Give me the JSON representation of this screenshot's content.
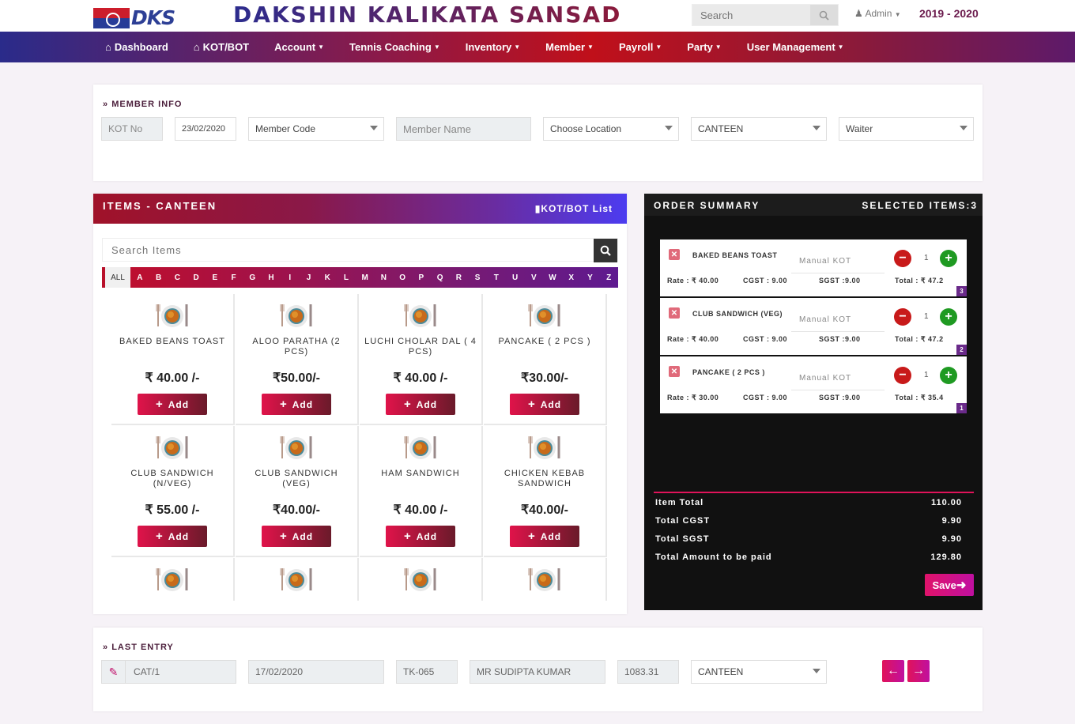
{
  "header": {
    "logo_text": "DKS",
    "brand": "DAKSHIN KALIKATA SANSAD",
    "search_placeholder": "Search",
    "user": "Admin",
    "year": "2019 - 2020"
  },
  "nav": [
    {
      "label": "Dashboard",
      "icon": "home-icon",
      "dropdown": false
    },
    {
      "label": "KOT/BOT",
      "icon": "home-icon",
      "dropdown": false
    },
    {
      "label": "Account",
      "dropdown": true
    },
    {
      "label": "Tennis Coaching",
      "dropdown": true
    },
    {
      "label": "Inventory",
      "dropdown": true
    },
    {
      "label": "Member",
      "dropdown": true
    },
    {
      "label": "Payroll",
      "dropdown": true
    },
    {
      "label": "Party",
      "dropdown": true
    },
    {
      "label": "User Management",
      "dropdown": true
    }
  ],
  "member_info": {
    "title": "MEMBER INFO",
    "kot_no_placeholder": "KOT No",
    "date": "23/02/2020",
    "member_code": "Member Code",
    "member_name_placeholder": "Member Name",
    "location": "Choose Location",
    "outlet": "CANTEEN",
    "waiter": "Waiter"
  },
  "items": {
    "title": "ITEMS - CANTEEN",
    "list_link": "KOT/BOT List",
    "search_placeholder": "Search Items",
    "alphabet": [
      "ALL",
      "A",
      "B",
      "C",
      "D",
      "E",
      "F",
      "G",
      "H",
      "I",
      "J",
      "K",
      "L",
      "M",
      "N",
      "O",
      "P",
      "Q",
      "R",
      "S",
      "T",
      "U",
      "V",
      "W",
      "X",
      "Y",
      "Z"
    ],
    "add_label": "Add",
    "products": [
      {
        "name": "BAKED BEANS TOAST",
        "price": "₹ 40.00 /-"
      },
      {
        "name": "ALOO PARATHA (2 PCS)",
        "price": "₹50.00/-"
      },
      {
        "name": "LUCHI CHOLAR DAL ( 4 PCS)",
        "price": "₹ 40.00 /-"
      },
      {
        "name": "PANCAKE ( 2 PCS )",
        "price": "₹30.00/-"
      },
      {
        "name": "CLUB SANDWICH (N/VEG)",
        "price": "₹ 55.00 /-"
      },
      {
        "name": "CLUB SANDWICH (VEG)",
        "price": "₹40.00/-"
      },
      {
        "name": "HAM SANDWICH",
        "price": "₹ 40.00 /-"
      },
      {
        "name": "CHICKEN KEBAB SANDWICH",
        "price": "₹40.00/-"
      },
      {
        "name": "",
        "price": ""
      },
      {
        "name": "",
        "price": ""
      },
      {
        "name": "",
        "price": ""
      },
      {
        "name": "",
        "price": ""
      }
    ]
  },
  "order": {
    "title": "ORDER SUMMARY",
    "selected": "SELECTED ITEMS:3",
    "lines": [
      {
        "name": "BAKED BEANS TOAST",
        "note": "Manual KOT",
        "qty": "1",
        "rate": "Rate : ₹ 40.00",
        "cgst": "CGST : 9.00",
        "sgst": "SGST :9.00",
        "total": "Total : ₹ 47.2",
        "badge": "3"
      },
      {
        "name": "CLUB SANDWICH (VEG)",
        "note": "Manual KOT",
        "qty": "1",
        "rate": "Rate : ₹ 40.00",
        "cgst": "CGST : 9.00",
        "sgst": "SGST :9.00",
        "total": "Total : ₹ 47.2",
        "badge": "2"
      },
      {
        "name": "PANCAKE ( 2 PCS )",
        "note": "Manual KOT",
        "qty": "1",
        "rate": "Rate : ₹ 30.00",
        "cgst": "CGST : 9.00",
        "sgst": "SGST :9.00",
        "total": "Total : ₹ 35.4",
        "badge": "1"
      }
    ],
    "totals": [
      {
        "label": "Item Total",
        "value": "110.00"
      },
      {
        "label": "Total CGST",
        "value": "9.90"
      },
      {
        "label": "Total SGST",
        "value": "9.90"
      },
      {
        "label": "Total Amount to be paid",
        "value": "129.80"
      }
    ],
    "save_label": "Save"
  },
  "last_entry": {
    "title": "LAST ENTRY",
    "code": "CAT/1",
    "date": "17/02/2020",
    "kot": "TK-065",
    "member": "MR SUDIPTA KUMAR",
    "amount": "1083.31",
    "outlet": "CANTEEN"
  }
}
